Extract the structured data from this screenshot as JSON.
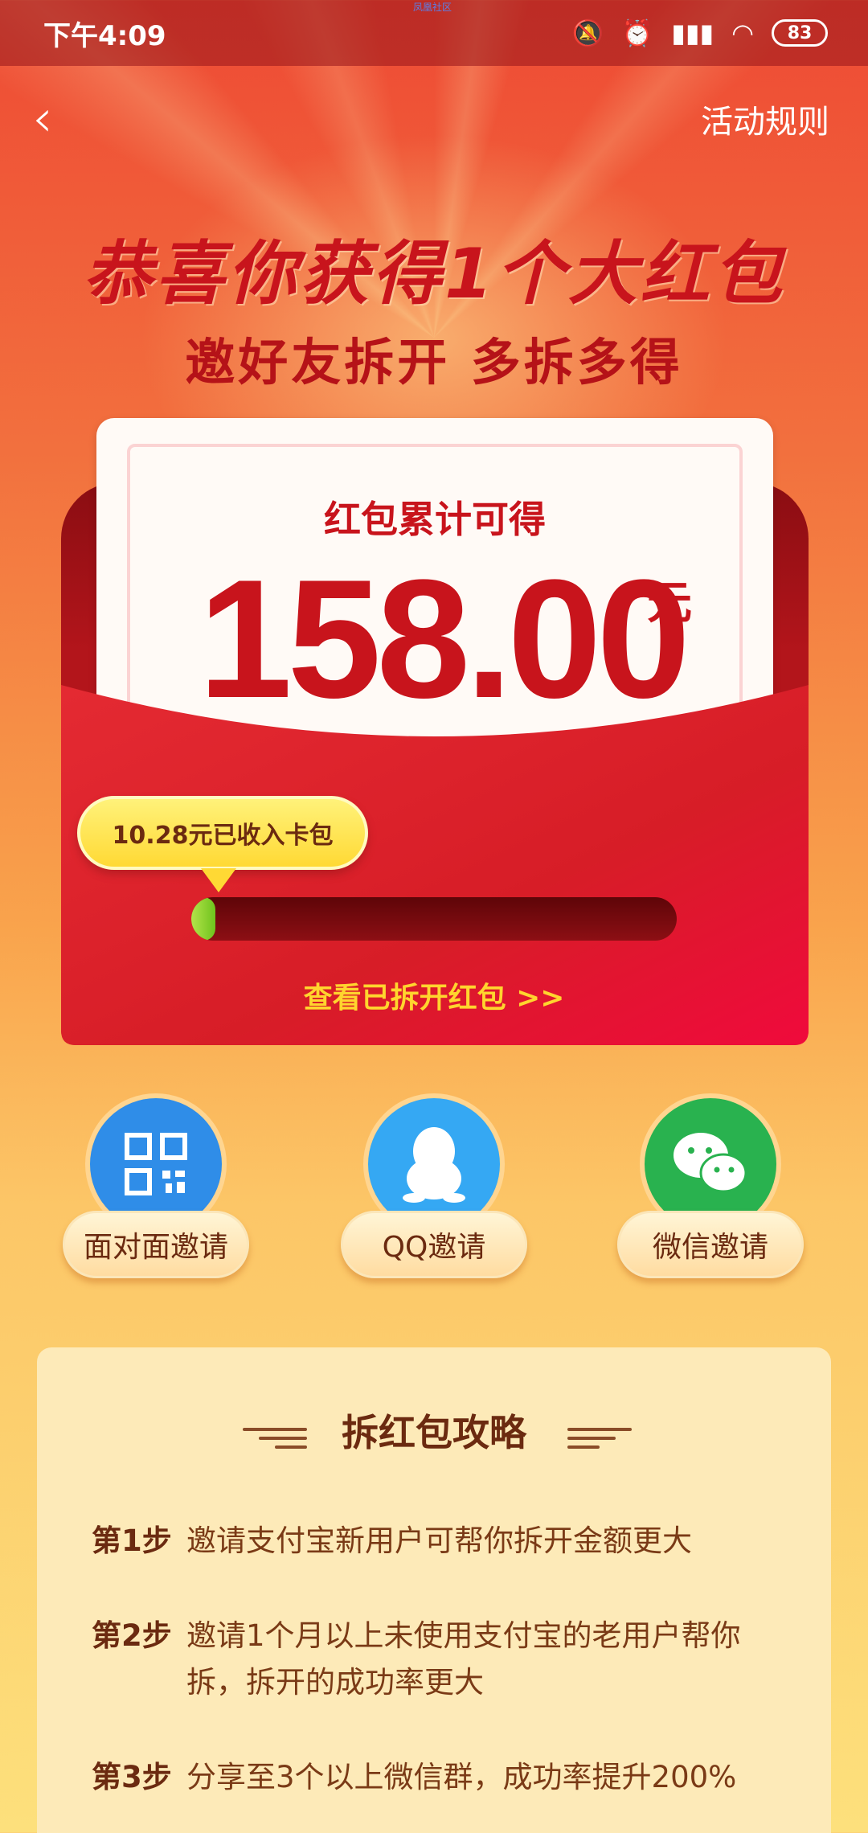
{
  "status_bar": {
    "time": "下午4:09",
    "battery": "83"
  },
  "watermark": "凤凰社区",
  "nav": {
    "rules_label": "活动规则"
  },
  "hero": {
    "headline": "恭喜你获得1个大红包",
    "subheadline": "邀好友拆开 多拆多得"
  },
  "packet": {
    "label": "红包累计可得",
    "amount": "158.00",
    "unit": "元",
    "tooltip": "10.28元已收入卡包",
    "progress": 0.03,
    "view_link": "查看已拆开红包 >>"
  },
  "invites": [
    {
      "label": "面对面邀请",
      "icon": "qr-code-icon",
      "color": "#2f8de8"
    },
    {
      "label": "QQ邀请",
      "icon": "qq-penguin-icon",
      "color": "#35a8f3"
    },
    {
      "label": "微信邀请",
      "icon": "wechat-icon",
      "color": "#29b24f"
    }
  ],
  "guide": {
    "title": "拆红包攻略",
    "steps": [
      {
        "no": "第1步",
        "text": "邀请支付宝新用户可帮你拆开金额更大"
      },
      {
        "no": "第2步",
        "text": "邀请1个月以上未使用支付宝的老用户帮你拆，拆开的成功率更大"
      },
      {
        "no": "第3步",
        "text": "分享至3个以上微信群，成功率提升200%"
      }
    ]
  }
}
